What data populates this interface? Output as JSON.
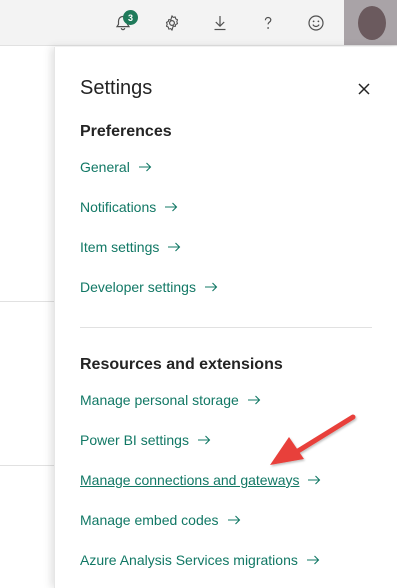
{
  "topbar": {
    "notification_count": "3",
    "icons": [
      "bell-icon",
      "gear-icon",
      "download-icon",
      "help-icon",
      "smiley-icon"
    ]
  },
  "settings": {
    "title": "Settings",
    "preferences": {
      "heading": "Preferences",
      "items": [
        "General",
        "Notifications",
        "Item settings",
        "Developer settings"
      ]
    },
    "resources": {
      "heading": "Resources and extensions",
      "items": [
        "Manage personal storage",
        "Power BI settings",
        "Manage connections and gateways",
        "Manage embed codes",
        "Azure Analysis Services migrations"
      ]
    }
  },
  "colors": {
    "link": "#117865",
    "badge": "#1f7a5a",
    "annotation_arrow": "#e8413a"
  }
}
